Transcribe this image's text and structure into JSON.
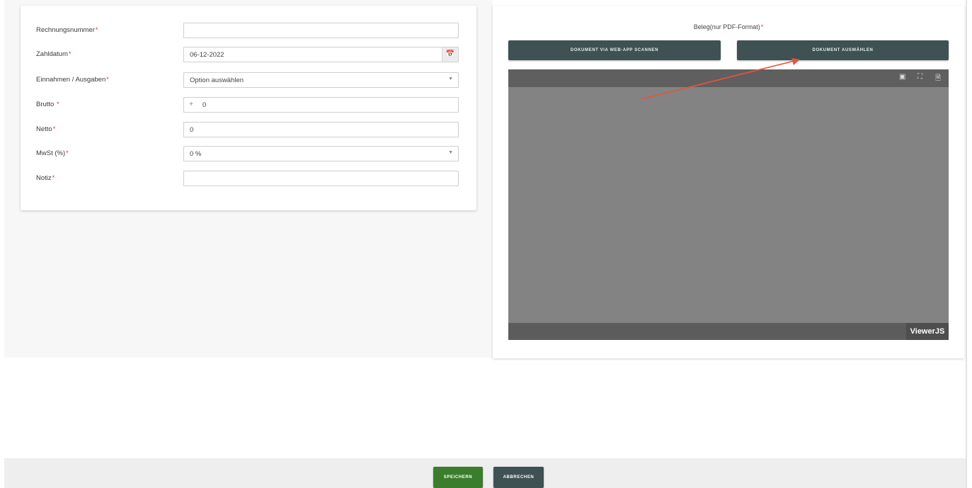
{
  "form": {
    "fields": [
      {
        "label": "Rechnungsnummer",
        "required": "*",
        "value": ""
      },
      {
        "label": "Zahldatum",
        "required": "*",
        "value": "06-12-2022",
        "icon": "calendar-icon"
      },
      {
        "label": "Einnahmen / Ausgaben",
        "required": "*",
        "value": "Option auswählen",
        "icon": "caret-down-icon"
      },
      {
        "label": "Brutto ",
        "required": "*",
        "prefix": "+",
        "value": "0"
      },
      {
        "label": "Netto",
        "required": "*",
        "value": "0"
      },
      {
        "label": "MwSt (%)",
        "required": "*",
        "value": "0 %",
        "icon": "caret-down-icon"
      },
      {
        "label": "Notiz",
        "required": "*",
        "value": ""
      }
    ]
  },
  "document": {
    "title": "Beleg(nur PDF-Format)",
    "required": "*",
    "scan_label": "DOKUMENT VIA WEB-APP SCANNEN",
    "select_label": "DOKUMENT AUSWÄHLEN",
    "viewer_brand": "ViewerJS",
    "viewer_icons": [
      "presentation-icon",
      "fullscreen-icon",
      "download-icon"
    ],
    "button_color": "#3e5153",
    "annotation_color": "#e8533a"
  },
  "footer": {
    "save_label": "SPEICHERN",
    "cancel_label": "ABBRECHEN",
    "save_color": "#3a7d2c",
    "cancel_color": "#3e5153"
  }
}
